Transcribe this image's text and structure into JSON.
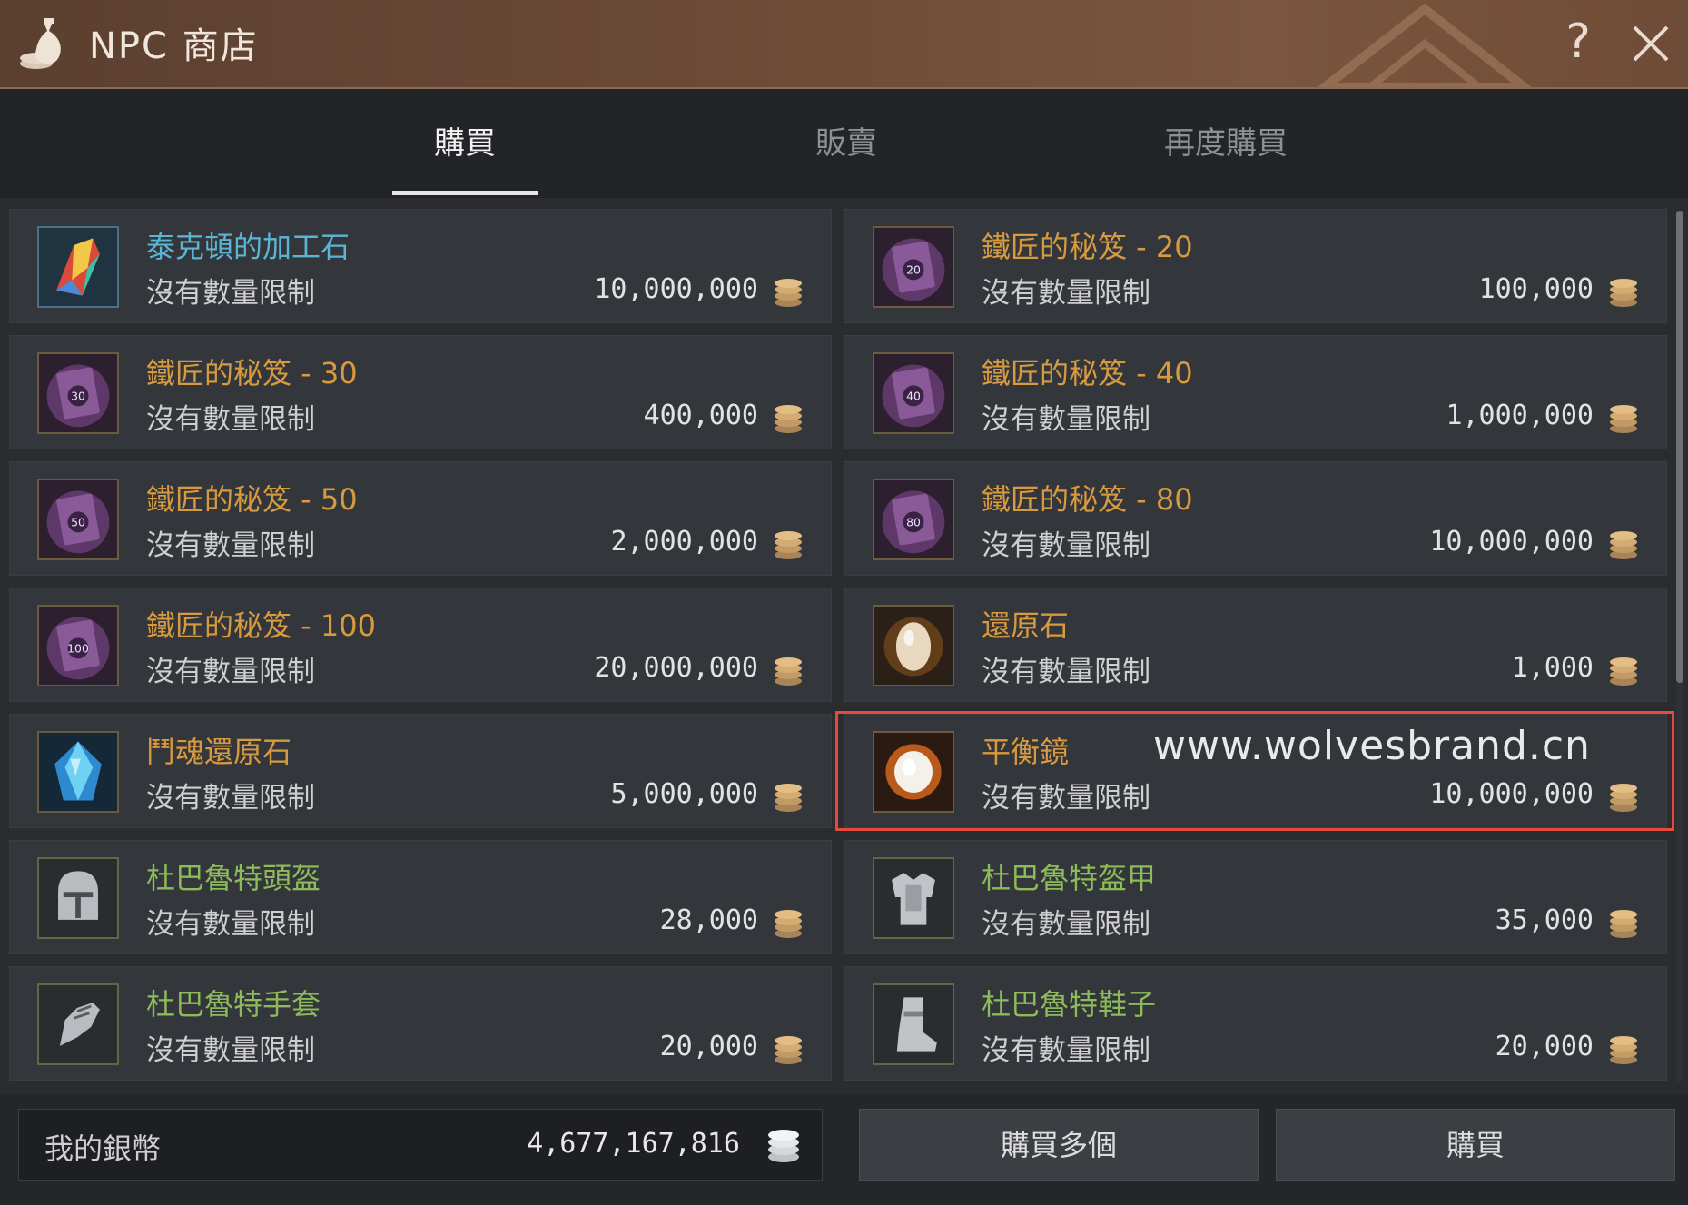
{
  "window": {
    "title": "NPC 商店"
  },
  "tabs": [
    {
      "label": "購買",
      "active": true
    },
    {
      "label": "販賣",
      "active": false
    },
    {
      "label": "再度購買",
      "active": false
    }
  ],
  "items": [
    {
      "name": "泰克頓的加工石",
      "limit": "沒有數量限制",
      "price": "10,000,000",
      "color": "blue",
      "icon": "crystal-icon"
    },
    {
      "name": "鐵匠的秘笈 - 20",
      "limit": "沒有數量限制",
      "price": "100,000",
      "color": "orange",
      "icon": "book-20-icon"
    },
    {
      "name": "鐵匠的秘笈 - 30",
      "limit": "沒有數量限制",
      "price": "400,000",
      "color": "orange",
      "icon": "book-30-icon"
    },
    {
      "name": "鐵匠的秘笈 - 40",
      "limit": "沒有數量限制",
      "price": "1,000,000",
      "color": "orange",
      "icon": "book-40-icon"
    },
    {
      "name": "鐵匠的秘笈 - 50",
      "limit": "沒有數量限制",
      "price": "2,000,000",
      "color": "orange",
      "icon": "book-50-icon"
    },
    {
      "name": "鐵匠的秘笈 - 80",
      "limit": "沒有數量限制",
      "price": "10,000,000",
      "color": "orange",
      "icon": "book-80-icon"
    },
    {
      "name": "鐵匠的秘笈 - 100",
      "limit": "沒有數量限制",
      "price": "20,000,000",
      "color": "orange",
      "icon": "book-100-icon"
    },
    {
      "name": "還原石",
      "limit": "沒有數量限制",
      "price": "1,000",
      "color": "orange",
      "icon": "restore-stone-icon"
    },
    {
      "name": "鬥魂還原石",
      "limit": "沒有數量限制",
      "price": "5,000,000",
      "color": "orange",
      "icon": "soul-stone-icon"
    },
    {
      "name": "平衡鏡",
      "limit": "沒有數量限制",
      "price": "10,000,000",
      "color": "orange",
      "icon": "mirror-icon"
    },
    {
      "name": "杜巴魯特頭盔",
      "limit": "沒有數量限制",
      "price": "28,000",
      "color": "green",
      "icon": "helmet-icon"
    },
    {
      "name": "杜巴魯特盔甲",
      "limit": "沒有數量限制",
      "price": "35,000",
      "color": "green",
      "icon": "armor-icon"
    },
    {
      "name": "杜巴魯特手套",
      "limit": "沒有數量限制",
      "price": "20,000",
      "color": "green",
      "icon": "gloves-icon"
    },
    {
      "name": "杜巴魯特鞋子",
      "limit": "沒有數量限制",
      "price": "20,000",
      "color": "green",
      "icon": "boots-icon"
    }
  ],
  "watermark": "www.wolvesbrand.cn",
  "footer": {
    "wallet_label": "我的銀幣",
    "wallet_amount": "4,677,167,816",
    "buy_multiple_label": "購買多個",
    "buy_label": "購買"
  },
  "colors": {
    "blue": "#5bb6d6",
    "orange": "#d89a3e",
    "green": "#8dbb5a",
    "highlight": "#e8493a"
  }
}
